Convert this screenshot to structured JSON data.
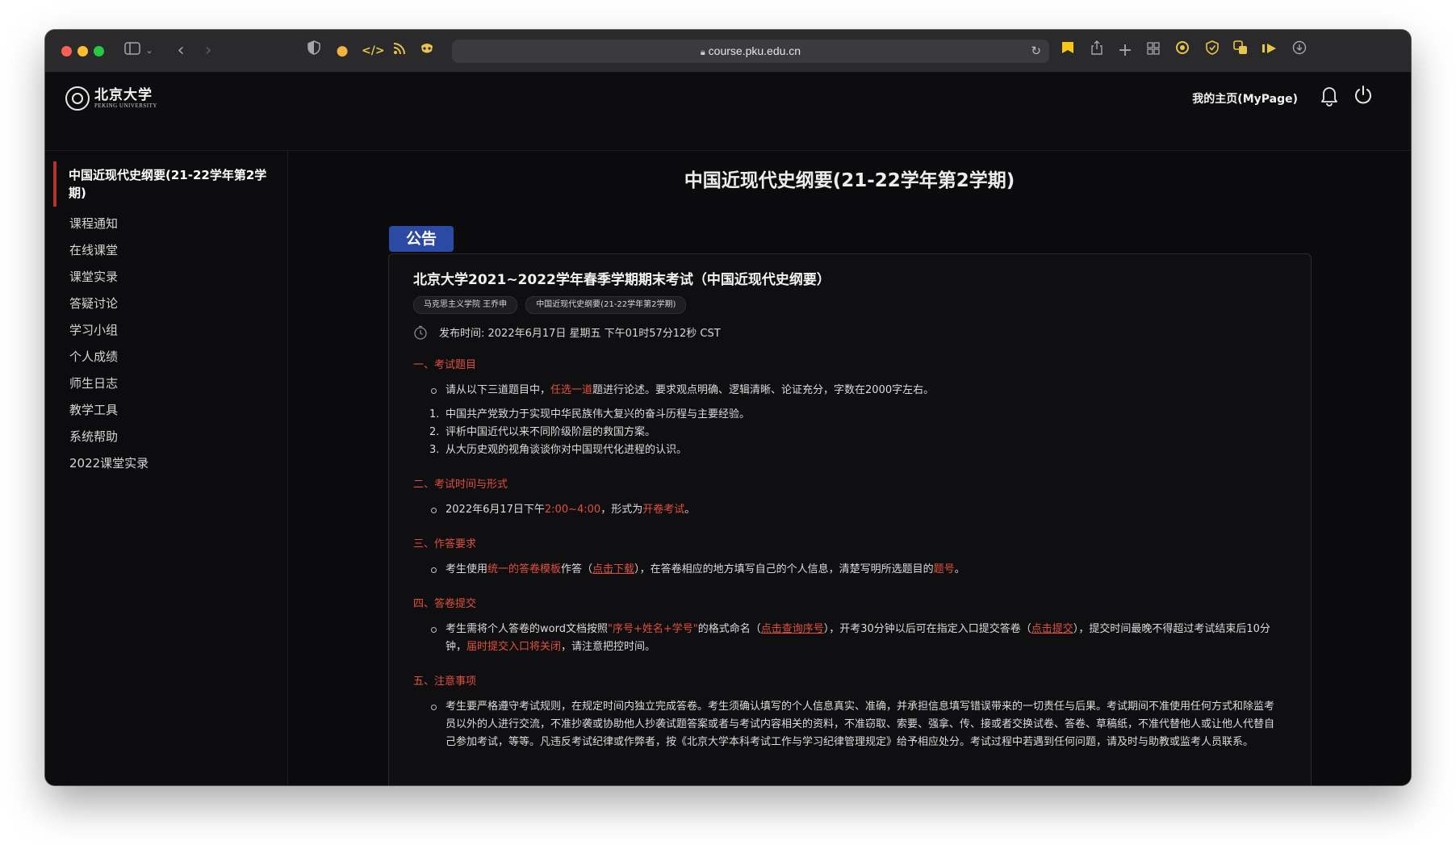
{
  "browser": {
    "url": "course.pku.edu.cn"
  },
  "site": {
    "logo_cn": "北京大学",
    "logo_en": "PEKING UNIVERSITY",
    "mypage": "我的主页(MyPage)"
  },
  "sidebar": {
    "active": "中国近现代史纲要(21-22学年第2学期)",
    "items": [
      "课程通知",
      "在线课堂",
      "课堂实录",
      "答疑讨论",
      "学习小组",
      "个人成绩",
      "师生日志",
      "教学工具",
      "系统帮助",
      "2022课堂实录"
    ]
  },
  "main": {
    "course_title": "中国近现代史纲要(21-22学年第2学期)",
    "badge": "公告",
    "post": {
      "title": "北京大学2021~2022学年春季学期期末考试（中国近现代史纲要）",
      "tags": [
        "马克思主义学院 王乔申",
        "中国近现代史纲要(21-22学年第2学期)"
      ],
      "pubtime": "发布时间: 2022年6月17日 星期五 下午01时57分12秒 CST",
      "s1": {
        "head": "一、考试题目",
        "b_a": "请从以下三道题目中，",
        "b_b": "任选一道",
        "b_c": "题进行论述。要求观点明确、逻辑清晰、论证充分，字数在2000字左右。",
        "items": [
          "中国共产党致力于实现中华民族伟大复兴的奋斗历程与主要经验。",
          "评析中国近代以来不同阶级阶层的救国方案。",
          "从大历史观的视角谈谈你对中国现代化进程的认识。"
        ]
      },
      "s2": {
        "head": "二、考试时间与形式",
        "b_a": "2022年6月17日下午",
        "b_b": "2:00~4:00",
        "b_c": "，形式为",
        "b_d": "开卷考试",
        "b_e": "。"
      },
      "s3": {
        "head": "三、作答要求",
        "b_a": "考生使用",
        "b_b": "统一的答卷模板",
        "b_c": "作答（",
        "b_link": "点击下载",
        "b_d": "），在答卷相应的地方填写自己的个人信息，清楚写明所选题目的",
        "b_e": "题号",
        "b_f": "。"
      },
      "s4": {
        "head": "四、答卷提交",
        "b_a": "考生需将个人答卷的word文档按照",
        "b_b": "\"序号+姓名+学号\"",
        "b_c": "的格式命名（",
        "b_link1": "点击查询序号",
        "b_d": "），开考30分钟以后可在指定入口提交答卷（",
        "b_link2": "点击提交",
        "b_e": "），提交时间最晚不得超过考试结束后10分钟，",
        "b_f": "届时提交入口将关闭",
        "b_g": "，请注意把控时间。"
      },
      "s5": {
        "head": "五、注意事项",
        "b_a": "考生要严格遵守考试规则，在规定时间内独立完成答卷。考生须确认填写的个人信息真实、准确，并承担信息填写错误带来的一切责任与后果。考试期间不准使用任何方式和除监考员以外的人进行交流，不准抄袭或协助他人抄袭试题答案或者与考试内容相关的资料，不准窃取、索要、强拿、传、接或者交换试卷、答卷、草稿纸，不准代替他人或让他人代替自己参加考试，等等。凡违反考试纪律或作弊者，按《北京大学本科考试工作与学习纪律管理规定》给予相应处分。考试过程中若遇到任何问题，请及时与助教或监考人员联系。"
      }
    }
  }
}
